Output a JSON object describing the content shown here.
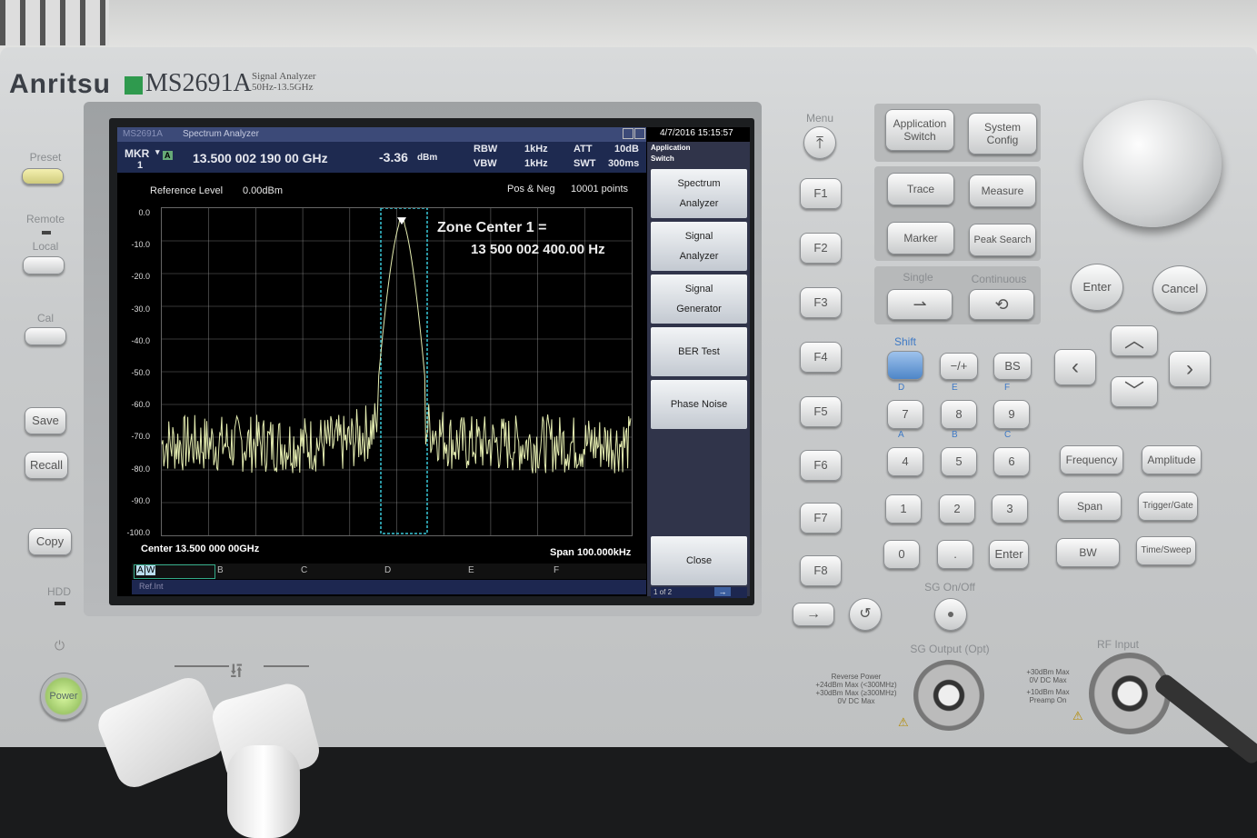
{
  "device": {
    "brand": "Anritsu",
    "model": "MS2691A",
    "subtitle_line1": "Signal Analyzer",
    "subtitle_line2": "50Hz-13.5GHz"
  },
  "screen": {
    "window_title": "Spectrum Analyzer",
    "window_model": "MS2691A",
    "datetime": "4/7/2016 15:15:57",
    "marker": {
      "label": "MKR",
      "index": "1",
      "mode": "A",
      "frequency": "13.500 002 190 00 GHz",
      "level": "-3.36",
      "level_unit": "dBm"
    },
    "rbw_label": "RBW",
    "rbw_value": "1kHz",
    "vbw_label": "VBW",
    "vbw_value": "1kHz",
    "att_label": "ATT",
    "att_value": "10dB",
    "swt_label": "SWT",
    "swt_value": "300ms",
    "reference_level_label": "Reference Level",
    "reference_level_value": "0.00dBm",
    "detection": "Pos & Neg",
    "points": "10001 points",
    "annotation_line1": "Zone Center 1 =",
    "annotation_line2": "13 500 002 400.00 Hz",
    "center": "Center 13.500 000 00GHz",
    "span": "Span 100.000kHz",
    "y_ticks": [
      "0.0",
      "-10.0",
      "-20.0",
      "-30.0",
      "-40.0",
      "-50.0",
      "-60.0",
      "-70.0",
      "-80.0",
      "-90.0",
      "-100.0"
    ],
    "traces": [
      "A",
      "B",
      "C",
      "D",
      "E",
      "F"
    ],
    "trace_a_label": "W",
    "status": "Ref.Int",
    "softkey_header_line1": "Application",
    "softkey_header_line2": "Switch",
    "softkeys": [
      {
        "line1": "Spectrum",
        "line2": "Analyzer"
      },
      {
        "line1": "Signal",
        "line2": "Analyzer"
      },
      {
        "line1": "Signal",
        "line2": "Generator"
      },
      {
        "line1": "BER Test",
        "line2": ""
      },
      {
        "line1": "Phase Noise",
        "line2": ""
      }
    ],
    "close_label": "Close",
    "page_indicator": "1 of 2"
  },
  "spectrum": {
    "noise_floor_db": -72,
    "peak_db": -3.36,
    "zone_center_hz": 13500002400.0
  },
  "panel": {
    "left": {
      "preset": "Preset",
      "remote": "Remote",
      "local": "Local",
      "cal": "Cal",
      "save": "Save",
      "recall": "Recall",
      "copy": "Copy",
      "hdd": "HDD",
      "power": "Power"
    },
    "menu_label": "Menu",
    "f_keys": [
      "F1",
      "F2",
      "F3",
      "F4",
      "F5",
      "F6",
      "F7",
      "F8"
    ],
    "right": {
      "application_switch": "Application Switch",
      "system_config": "System Config",
      "trace": "Trace",
      "measure": "Measure",
      "marker": "Marker",
      "peak_search": "Peak Search",
      "single": "Single",
      "continuous": "Continuous",
      "enter": "Enter",
      "cancel": "Cancel",
      "shift": "Shift",
      "minus_plus": "−/+",
      "bs": "BS",
      "hex_labels": [
        "D",
        "E",
        "F",
        "A",
        "B",
        "C"
      ],
      "keypad": [
        "7",
        "8",
        "9",
        "4",
        "5",
        "6",
        "1",
        "2",
        "3",
        "0",
        ".",
        "Enter"
      ],
      "frequency": "Frequency",
      "amplitude": "Amplitude",
      "span": "Span",
      "trigger_gate": "Trigger/Gate",
      "bw": "BW",
      "time_sweep": "Time/Sweep",
      "sg_on_off": "SG On/Off",
      "sg_output": "SG Output (Opt)",
      "rf_input": "RF Input",
      "reverse_power": "Reverse Power",
      "rp_line1": "+24dBm Max (<300MHz)",
      "rp_line2": "+30dBm Max (≥300MHz)",
      "rp_line3": "0V DC Max",
      "rf_line1": "+30dBm Max",
      "rf_line2": "0V DC Max",
      "rf_line3": "+10dBm Max",
      "rf_line4": "Preamp On"
    }
  },
  "colors": {
    "trace": "#e4ecb0",
    "zone": "#38c8d8",
    "grid": "#9a9a9a",
    "brand_green": "#2f9a4e",
    "power_led": "#b8f070"
  }
}
